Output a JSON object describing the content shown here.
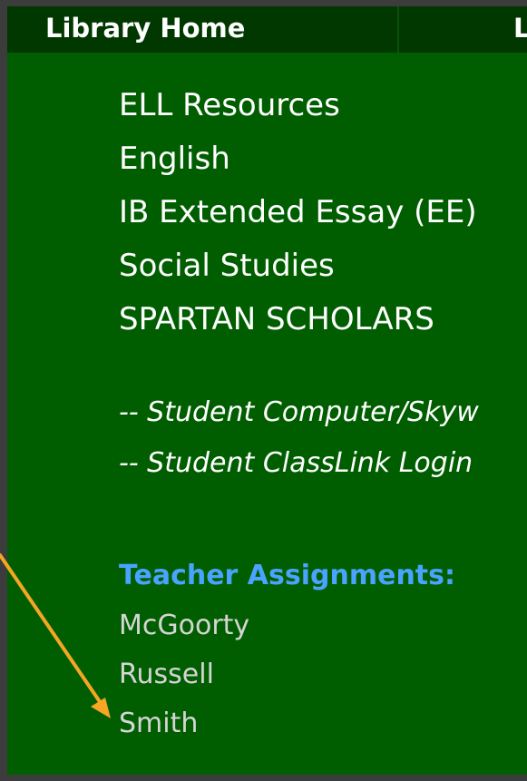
{
  "nav": {
    "home_label": "Library Home",
    "next_label": "L"
  },
  "menu": {
    "items": [
      "ELL Resources",
      "English",
      "IB Extended Essay (EE)",
      "Social Studies",
      "SPARTAN SCHOLARS"
    ]
  },
  "links": {
    "items": [
      "-- Student Computer/Skyw",
      "-- Student ClassLink Login"
    ]
  },
  "teachers": {
    "heading": "Teacher Assignments:",
    "items": [
      "McGoorty",
      "Russell",
      "Smith"
    ]
  },
  "colors": {
    "panel_bg": "#005e00",
    "topbar_bg": "#003800",
    "heading_blue": "#4aa3ff",
    "teacher_gray": "#d5d5d5",
    "arrow_orange": "#f5a623"
  }
}
